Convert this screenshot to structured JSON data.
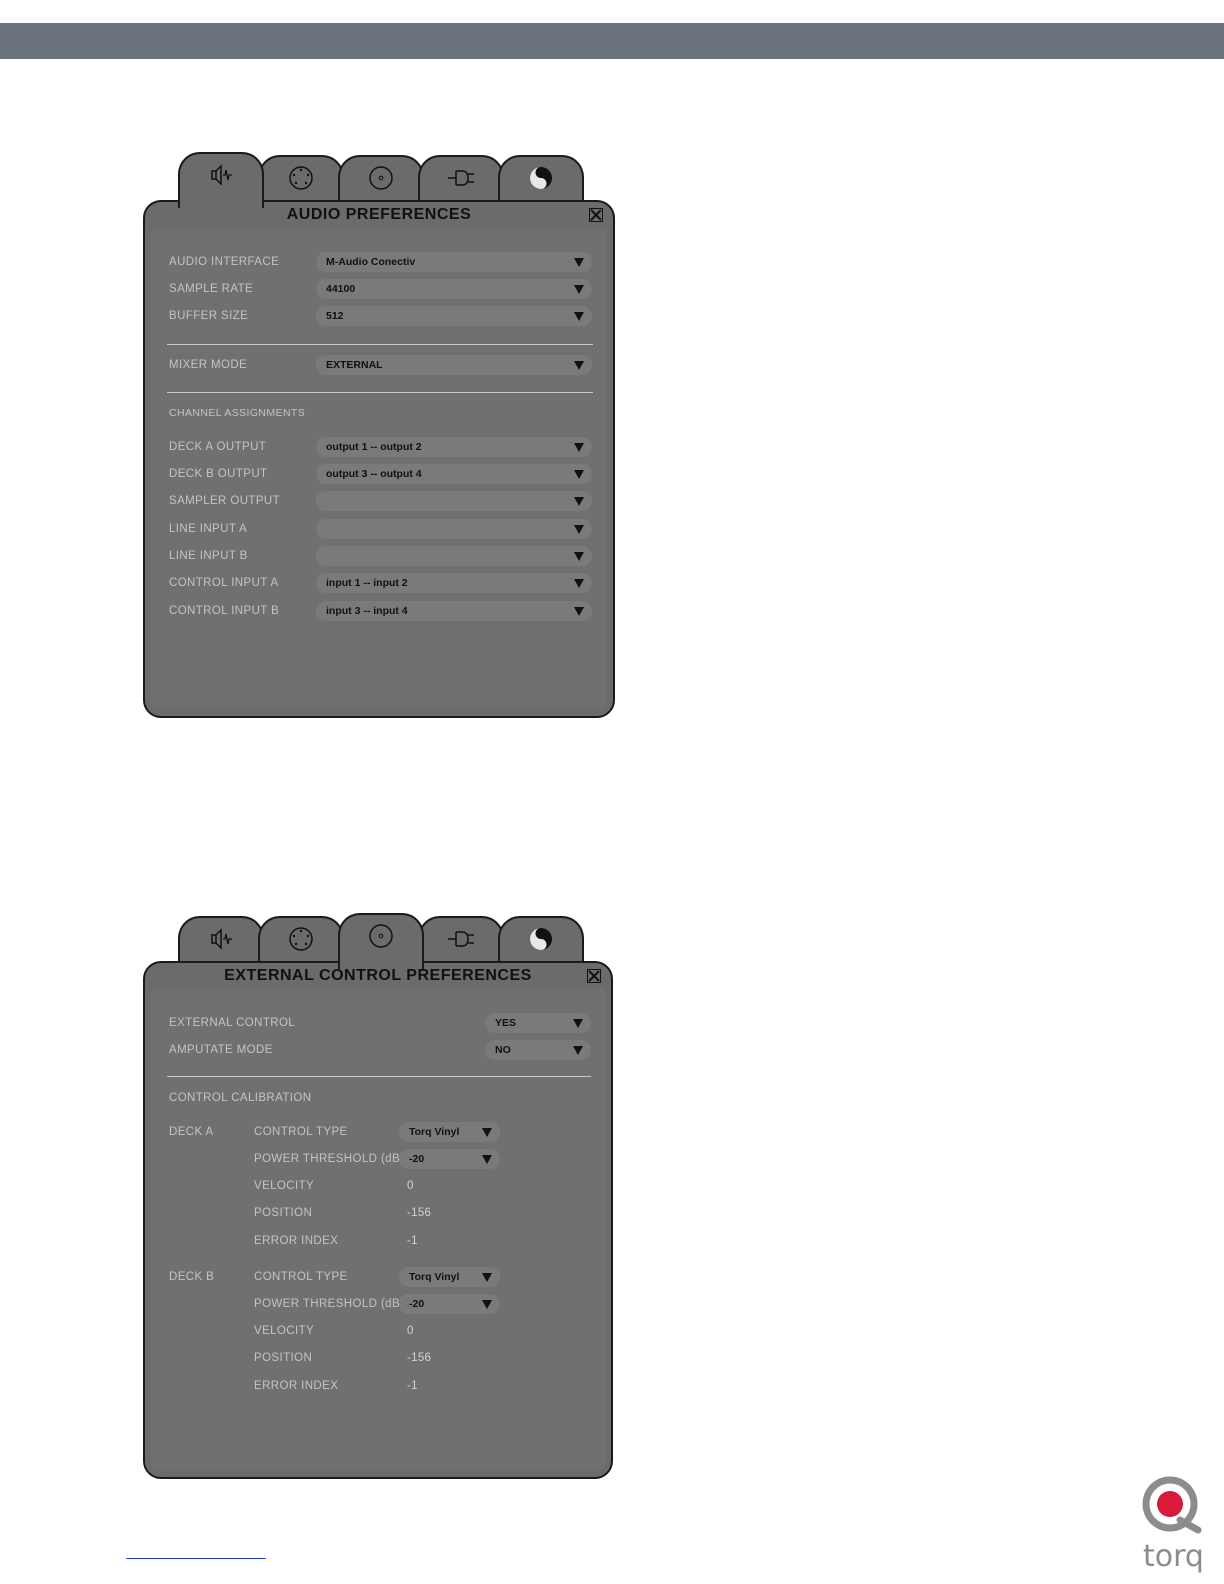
{
  "audio_prefs": {
    "title": "AUDIO PREFERENCES",
    "tabs": [
      "speaker-icon",
      "midi-icon",
      "record-icon",
      "plug-icon",
      "yin-yang-icon"
    ],
    "active_tab": 0,
    "rows": [
      {
        "label": "AUDIO INTERFACE",
        "value": "M-Audio Conectiv"
      },
      {
        "label": "SAMPLE RATE",
        "value": "44100"
      },
      {
        "label": "BUFFER SIZE",
        "value": "512"
      }
    ],
    "mixer": {
      "label": "MIXER MODE",
      "value": "EXTERNAL"
    },
    "channel_heading": "CHANNEL ASSIGNMENTS",
    "channels": [
      {
        "label": "DECK A OUTPUT",
        "value": "output 1 -- output 2"
      },
      {
        "label": "DECK B OUTPUT",
        "value": "output 3 -- output 4"
      },
      {
        "label": "SAMPLER OUTPUT",
        "value": ""
      },
      {
        "label": "LINE INPUT A",
        "value": ""
      },
      {
        "label": "LINE INPUT B",
        "value": ""
      },
      {
        "label": "CONTROL INPUT A",
        "value": "input 1 -- input 2"
      },
      {
        "label": "CONTROL INPUT B",
        "value": "input 3 -- input 4"
      }
    ]
  },
  "ext_prefs": {
    "title": "EXTERNAL CONTROL PREFERENCES",
    "active_tab": 2,
    "external_control": {
      "label": "EXTERNAL CONTROL",
      "value": "YES"
    },
    "amputate_mode": {
      "label": "AMPUTATE MODE",
      "value": "NO"
    },
    "calibration_heading": "CONTROL CALIBRATION",
    "decks": [
      {
        "name": "DECK A",
        "control_type": {
          "label": "CONTROL TYPE",
          "value": "Torq Vinyl"
        },
        "power_threshold": {
          "label": "POWER THRESHOLD (dB)",
          "value": "-20"
        },
        "velocity": {
          "label": "VELOCITY",
          "value": "0"
        },
        "position": {
          "label": "POSITION",
          "value": "-156"
        },
        "error_index": {
          "label": "ERROR INDEX",
          "value": "-1"
        }
      },
      {
        "name": "DECK B",
        "control_type": {
          "label": "CONTROL TYPE",
          "value": "Torq Vinyl"
        },
        "power_threshold": {
          "label": "POWER THRESHOLD (dB)",
          "value": "-20"
        },
        "velocity": {
          "label": "VELOCITY",
          "value": "0"
        },
        "position": {
          "label": "POSITION",
          "value": "-156"
        },
        "error_index": {
          "label": "ERROR INDEX",
          "value": "-1"
        }
      }
    ]
  },
  "colors": {
    "header_bar": "#6a737d",
    "panel": "#6b6b6b",
    "logo_red": "#d91a3a",
    "logo_gray": "#8c8c8c"
  },
  "logo_text": "torq"
}
